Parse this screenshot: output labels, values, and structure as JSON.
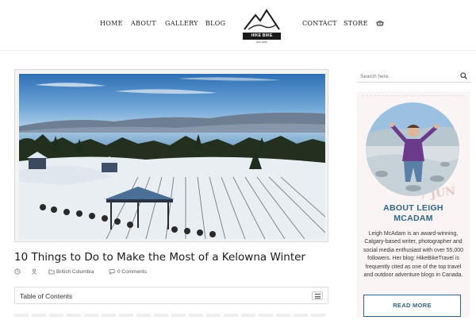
{
  "nav": {
    "items_left": [
      "HOME",
      "ABOUT",
      "GALLERY",
      "BLOG"
    ],
    "items_right": [
      "CONTACT",
      "STORE"
    ],
    "logo_text": "HIKE BIKE TRAVEL",
    "logo_subtext": "EST 2009"
  },
  "post": {
    "title": "10 Things to Do to Make the Most of a Kelowna Winter",
    "category": "British Columbia",
    "comments": "0 Comments",
    "toc_label": "Table of Contents"
  },
  "sidebar": {
    "search_placeholder": "Search here.",
    "about_title_line1": "ABOUT LEIGH",
    "about_title_line2": "MCADAM",
    "about_text": "Leigh McAdam is an award-winning, Calgary-based writer, photographer and social media enthusiast with over 55,000 followers. Her blog: HikeBikeTravel is frequently cited as one of the top travel and outdoor adventure blogs in Canada.",
    "read_more": "READ MORE",
    "stamp_text": "7 JUN"
  },
  "colors": {
    "accent": "#2e6689",
    "about_bg": "#fbf4f4"
  },
  "icons": [
    "cart-icon",
    "search-icon",
    "clock-icon",
    "user-icon",
    "folder-icon",
    "comment-icon",
    "list-toggle-icon"
  ]
}
